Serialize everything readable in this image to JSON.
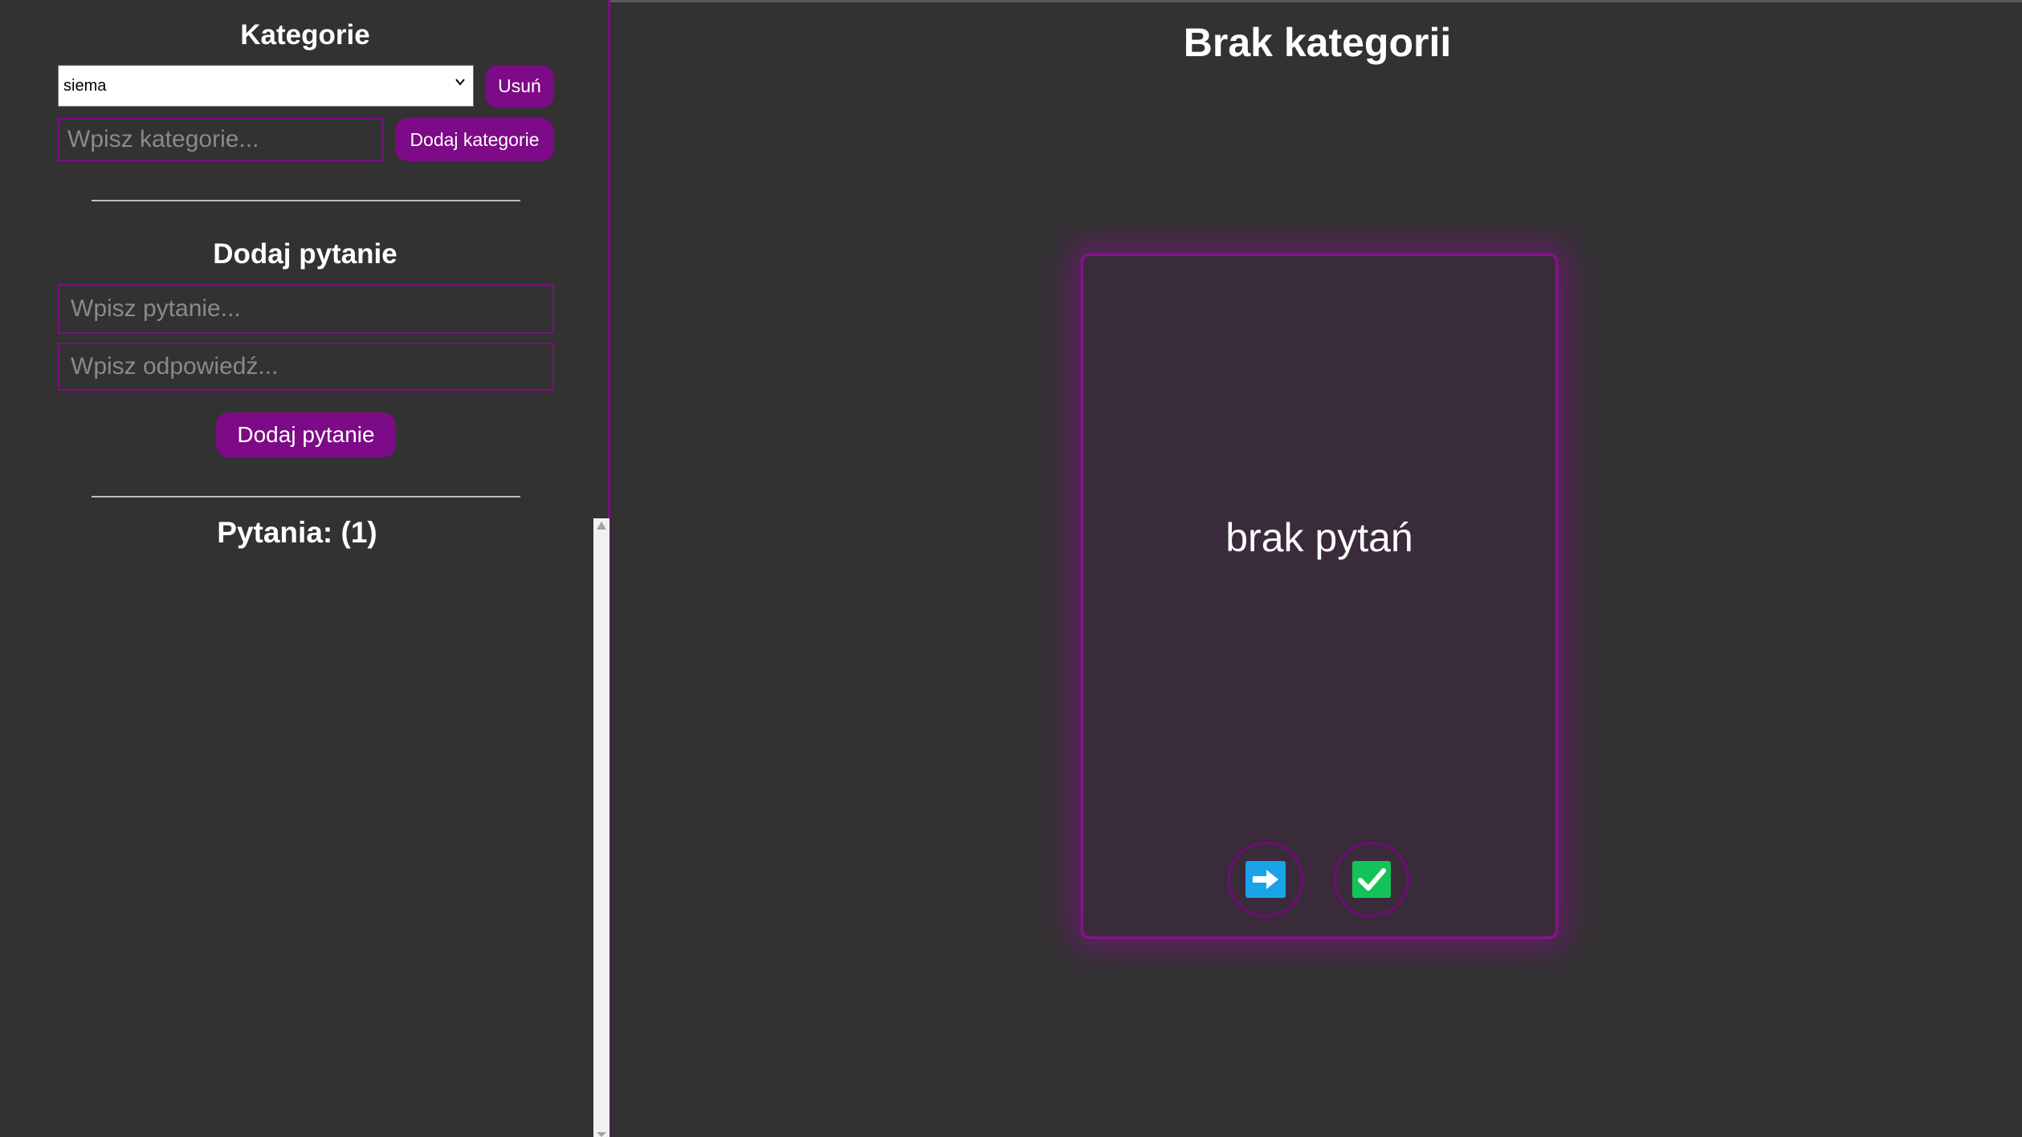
{
  "sidebar": {
    "categories_heading": "Kategorie",
    "category_select": {
      "selected": "siema"
    },
    "delete_button": "Usuń",
    "category_input": {
      "placeholder": "Wpisz kategorie..."
    },
    "add_category_button": "Dodaj kategorie",
    "add_question_heading": "Dodaj pytanie",
    "question_input": {
      "placeholder": "Wpisz pytanie..."
    },
    "answer_input": {
      "placeholder": "Wpisz odpowiedź..."
    },
    "add_question_button": "Dodaj pytanie",
    "questions_heading": "Pytania: (1)"
  },
  "main": {
    "title": "Brak kategorii",
    "card_text": "brak pytań",
    "next_icon": "arrow-right-icon",
    "check_icon": "check-mark-icon"
  },
  "colors": {
    "background": "#323232",
    "accent": "#7d0a86",
    "next_icon": "#1aa3e8",
    "check_icon": "#13c35a"
  }
}
